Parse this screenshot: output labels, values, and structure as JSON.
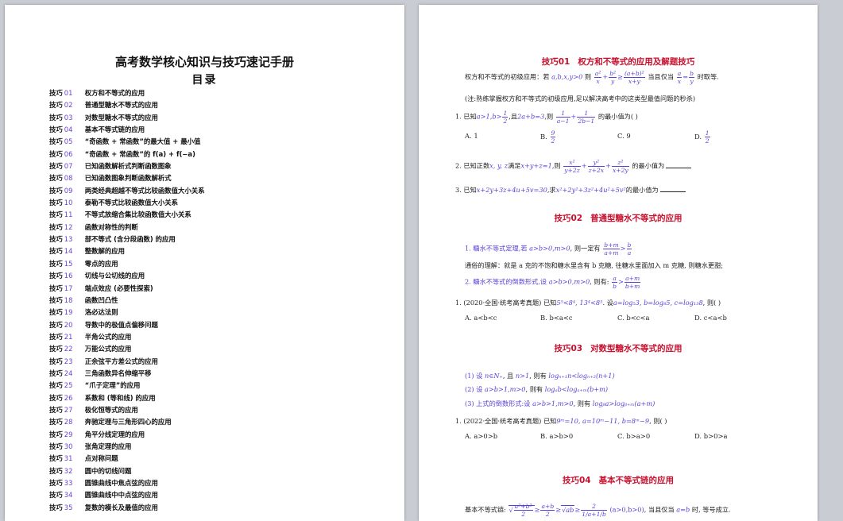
{
  "left_page": {
    "title": "高考数学核心知识与技巧速记手册",
    "toc_heading": "目录",
    "toc_prefix": "技巧",
    "toc": [
      {
        "num": "01",
        "title": "权方和不等式的应用"
      },
      {
        "num": "02",
        "title": "普通型糖水不等式的应用"
      },
      {
        "num": "03",
        "title": "对数型糖水不等式的应用"
      },
      {
        "num": "04",
        "title": "基本不等式链的应用"
      },
      {
        "num": "05",
        "title": "“奇函数 + 常函数”的最大值 + 最小值"
      },
      {
        "num": "06",
        "title": "“奇函数 + 常函数”的 f(a) + f(−a)"
      },
      {
        "num": "07",
        "title": "已知函数解析式判断函数图象"
      },
      {
        "num": "08",
        "title": "已知函数图象判断函数解析式"
      },
      {
        "num": "09",
        "title": "两类经典超越不等式比较函数值大小关系"
      },
      {
        "num": "10",
        "title": "泰勒不等式比较函数值大小关系"
      },
      {
        "num": "11",
        "title": "不等式放缩合集比较函数值大小关系"
      },
      {
        "num": "12",
        "title": "函数对称性的判断"
      },
      {
        "num": "13",
        "title": "部不等式 (含分段函数) 的应用"
      },
      {
        "num": "14",
        "title": "整数解的应用"
      },
      {
        "num": "15",
        "title": "零点的应用"
      },
      {
        "num": "16",
        "title": "切线与公切线的应用"
      },
      {
        "num": "17",
        "title": "端点效应 (必要性探索)"
      },
      {
        "num": "18",
        "title": "函数凹凸性"
      },
      {
        "num": "19",
        "title": "洛必达法则"
      },
      {
        "num": "20",
        "title": "导数中的极值点偏移问题"
      },
      {
        "num": "21",
        "title": "半角公式的应用"
      },
      {
        "num": "22",
        "title": "万能公式的应用"
      },
      {
        "num": "23",
        "title": "正余弦平方差公式的应用"
      },
      {
        "num": "24",
        "title": "三角函数异名伸缩平移"
      },
      {
        "num": "25",
        "title": "“爪子定理”的应用"
      },
      {
        "num": "26",
        "title": "系数和 (等和线) 的应用"
      },
      {
        "num": "27",
        "title": "极化恒等式的应用"
      },
      {
        "num": "28",
        "title": "奔驰定理与三角形四心的应用"
      },
      {
        "num": "29",
        "title": "角平分线定理的应用"
      },
      {
        "num": "30",
        "title": "张角定理的应用"
      },
      {
        "num": "31",
        "title": "点对称问题"
      },
      {
        "num": "32",
        "title": "圆中的切线问题"
      },
      {
        "num": "33",
        "title": "圆锥曲线中焦点弦的应用"
      },
      {
        "num": "34",
        "title": "圆锥曲线中中点弦的应用"
      },
      {
        "num": "35",
        "title": "复数的模长及最值的应用"
      }
    ]
  },
  "right_page": {
    "s1": {
      "prefix": "技巧",
      "num": "01",
      "title": "权方和不等式的应用及解题技巧",
      "intro_a": "权方和不等式的初级应用：若",
      "intro_vars": "a,b,x,y>0",
      "intro_b": "则",
      "intro_c": "当且仅当",
      "intro_d": "时取等.",
      "note": "(注:熟练掌握权方和不等式的初级应用,足以解决高考中的这类型最值问题的秒杀)",
      "q1_a": "1. 已知",
      "q1_cond": "a>1,b>",
      "q1_b": ",且",
      "q1_c": "2a+b=3",
      "q1_d": ",则",
      "q1_e": "的最小值为(     )",
      "q1_opts": [
        "A. 1",
        "B.",
        "C. 9",
        "D."
      ],
      "q2_a": "2. 已知正数",
      "q2_vars": "x, y, z",
      "q2_b": "满足",
      "q2_c": "x+y+z=1",
      "q2_d": ",则",
      "q2_e": "的最小值为",
      "q3_a": "3. 已知",
      "q3_c": "x+2y+3z+4u+5v=30",
      "q3_d": ",求",
      "q3_e": "x²+2y²+3z²+4u²+5v²",
      "q3_f": "的最小值为"
    },
    "s2": {
      "prefix": "技巧",
      "num": "02",
      "title": "普通型糖水不等式的应用",
      "l1_a": "1. 糖水不等式定理,若",
      "l1_b": "a>b>0,m>0",
      "l1_c": ", 则一定有",
      "l2": "通俗的理解：就是 a 克的不饱和糖水里含有 b 克糖, 往糖水里面加入 m 克糖, 则糖水更甜;",
      "l3_a": "2.  糖水不等式的倒数形式,设",
      "l3_b": "a>b>0,m>0",
      "l3_c": ", 则有:",
      "q_a": "1. (2020·全国·统考高考真题) 已知",
      "q_b": "5⁵<8⁴, 13⁴<8⁵",
      "q_c": ". 设",
      "q_d": "a=log₅3, b=log₈5, c=log₁₃8",
      "q_e": ", 则(     )",
      "opts": [
        "A. a<b<c",
        "B. b<a<c",
        "C. b<c<a",
        "D. c<a<b"
      ]
    },
    "s3": {
      "prefix": "技巧",
      "num": "03",
      "title": "对数型糖水不等式的应用",
      "l1_a": "(1) 设",
      "l1_b": "n∈N₊",
      "l1_c": ", 且",
      "l1_d": "n>1",
      "l1_e": ", 则有",
      "l1_f": "logₙ₊₁n<logₙ₊₂(n+1)",
      "l2_a": "(2) 设",
      "l2_b": "a>b>1,m>0",
      "l2_c": ", 则有",
      "l2_d": "logₐb<logₐ₊ₘ(b+m)",
      "l3_a": "(3) 上式的倒数形式:设",
      "l3_b": "a>b>1,m>0",
      "l3_c": ", 则有",
      "l3_d": "logᵦa>logᵦ₊ₘ(a+m)",
      "q_a": "1. (2022·全国·统考高考真题) 已知",
      "q_b": "9ᵐ=10, a=10ᵐ−11, b=8ᵐ−9",
      "q_c": ", 则(     )",
      "opts": [
        "A. a>0>b",
        "B. a>b>0",
        "C. b>a>0",
        "D. b>0>a"
      ]
    },
    "s4": {
      "prefix": "技巧",
      "num": "04",
      "title": "基本不等式链的应用",
      "l1_a": "基本不等式链:",
      "l1_b": "(a>0,b>0)",
      "l1_c": ", 当且仅当",
      "l1_d": "a=b",
      "l1_e": "时, 等号成立."
    }
  }
}
